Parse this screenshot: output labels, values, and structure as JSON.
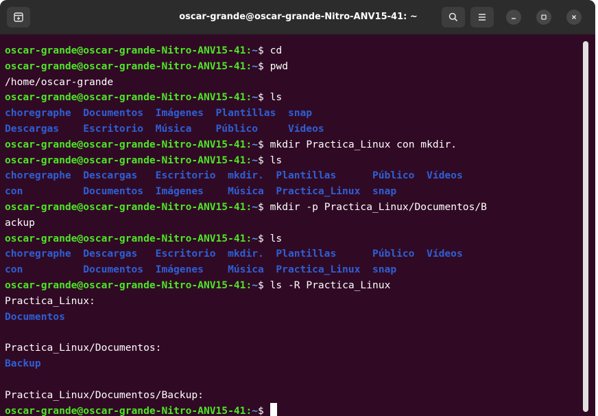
{
  "window": {
    "title": "oscar-grande@oscar-grande-Nitro-ANV15-41: ~"
  },
  "titlebar": {
    "new_tab_icon": "new-tab-icon",
    "search_icon": "search-icon",
    "menu_icon": "hamburger-menu-icon",
    "minimize_icon": "minimize-icon",
    "maximize_icon": "maximize-icon",
    "close_icon": "close-icon"
  },
  "colors": {
    "background": "#300a24",
    "titlebar": "#2c2c2c",
    "prompt_user": "#4ee627",
    "prompt_path": "#5b9bf0",
    "directory": "#2f5fd6",
    "text": "#ffffff"
  },
  "prompt": {
    "user": "oscar-grande@oscar-grande-Nitro-ANV15-41",
    "colon": ":",
    "path": "~",
    "symbol": "$"
  },
  "terminal": {
    "lines": [
      {
        "type": "cmd",
        "text": "cd"
      },
      {
        "type": "cmd",
        "text": "pwd"
      },
      {
        "type": "out",
        "text": "/home/oscar-grande"
      },
      {
        "type": "cmd",
        "text": "ls"
      },
      {
        "type": "dirs",
        "text": "choregraphe  Documentos  Imágenes  Plantillas  snap"
      },
      {
        "type": "dirs",
        "text": "Descargas    Escritorio  Música    Público     Vídeos"
      },
      {
        "type": "cmd",
        "text": "mkdir Practica_Linux con mkdir."
      },
      {
        "type": "cmd",
        "text": "ls"
      },
      {
        "type": "dirs",
        "text": "choregraphe  Descargas   Escritorio  mkdir.  Plantillas      Público  Vídeos"
      },
      {
        "type": "dirs",
        "text": "con          Documentos  Imágenes    Música  Practica_Linux  snap"
      },
      {
        "type": "cmd",
        "text": "mkdir -p Practica_Linux/Documentos/B"
      },
      {
        "type": "out",
        "text": "ackup"
      },
      {
        "type": "cmd",
        "text": "ls"
      },
      {
        "type": "dirs",
        "text": "choregraphe  Descargas   Escritorio  mkdir.  Plantillas      Público  Vídeos"
      },
      {
        "type": "dirs",
        "text": "con          Documentos  Imágenes    Música  Practica_Linux  snap"
      },
      {
        "type": "cmd",
        "text": "ls -R Practica_Linux"
      },
      {
        "type": "out",
        "text": "Practica_Linux:"
      },
      {
        "type": "dirs",
        "text": "Documentos"
      },
      {
        "type": "out",
        "text": ""
      },
      {
        "type": "out",
        "text": "Practica_Linux/Documentos:"
      },
      {
        "type": "dirs",
        "text": "Backup"
      },
      {
        "type": "out",
        "text": ""
      },
      {
        "type": "out",
        "text": "Practica_Linux/Documentos/Backup:"
      },
      {
        "type": "cmd",
        "text": ""
      }
    ]
  }
}
